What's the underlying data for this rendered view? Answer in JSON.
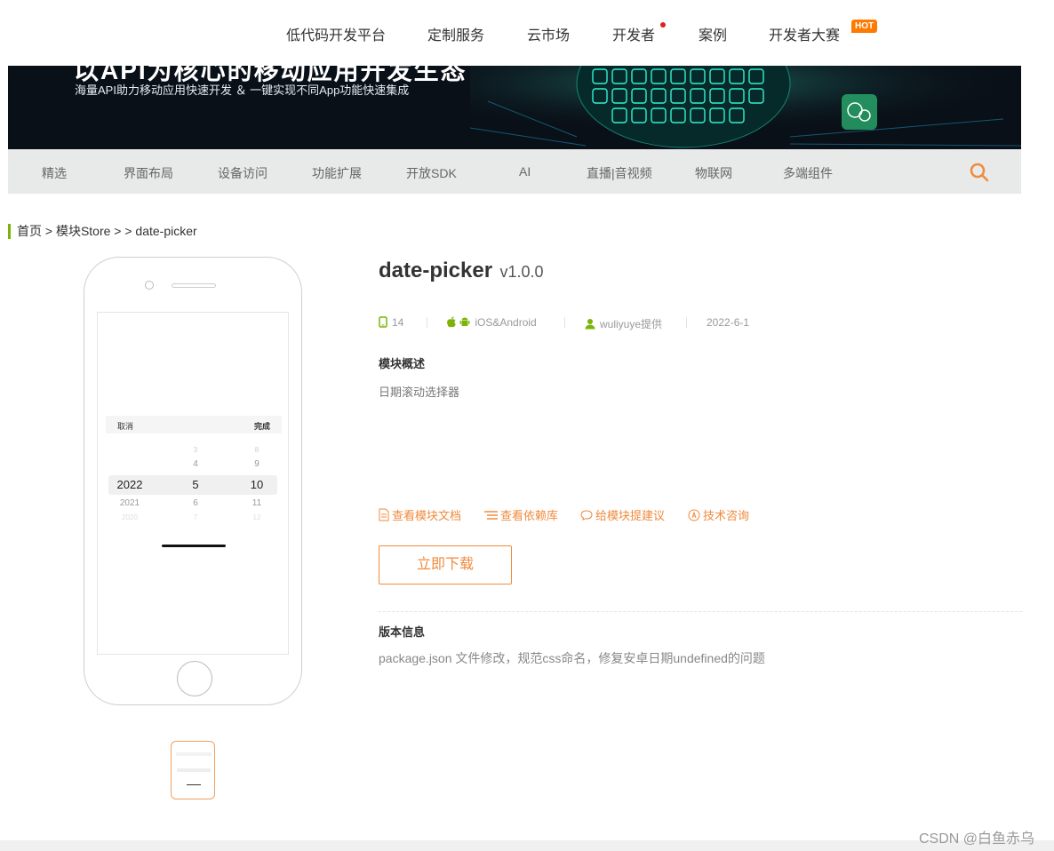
{
  "topnav": {
    "items": [
      "低代码开发平台",
      "定制服务",
      "云市场",
      "开发者",
      "案例",
      "开发者大赛"
    ],
    "hot_badge": "HOT"
  },
  "banner": {
    "title_cut": "以API为核心的移动应用开发生态",
    "subtitle": "海量API助力移动应用快速开发 ＆ 一键实现不同App功能快速集成"
  },
  "categories": [
    "精选",
    "界面布局",
    "设备访问",
    "功能扩展",
    "开放SDK",
    "AI",
    "直播|音视频",
    "物联网",
    "多端组件"
  ],
  "breadcrumb": "首页 > 模块Store > > date-picker",
  "preview": {
    "cancel": "取消",
    "done": "完成",
    "col1": [
      "2022",
      "2021",
      "2020"
    ],
    "col2": [
      "3",
      "4",
      "5",
      "6",
      "7"
    ],
    "col3": [
      "8",
      "9",
      "10",
      "11",
      "12"
    ]
  },
  "module": {
    "name": "date-picker",
    "version": "v1.0.0",
    "count": "14",
    "platform": "iOS&Android",
    "author": "wuliyuye提供",
    "date": "2022-6-1",
    "overview_heading": "模块概述",
    "overview": "日期滚动选择器",
    "links": [
      "查看模块文档",
      "查看依赖库",
      "给模块提建议",
      "技术咨询"
    ],
    "download": "立即下载",
    "version_heading": "版本信息",
    "version_notes": "package.json 文件修改，规范css命名，修复安卓日期undefined的问题"
  },
  "colors": {
    "accent": "#f08a3c",
    "green": "#7cb305",
    "hot": "#ff7a00"
  },
  "watermark": "CSDN @白鱼赤乌"
}
